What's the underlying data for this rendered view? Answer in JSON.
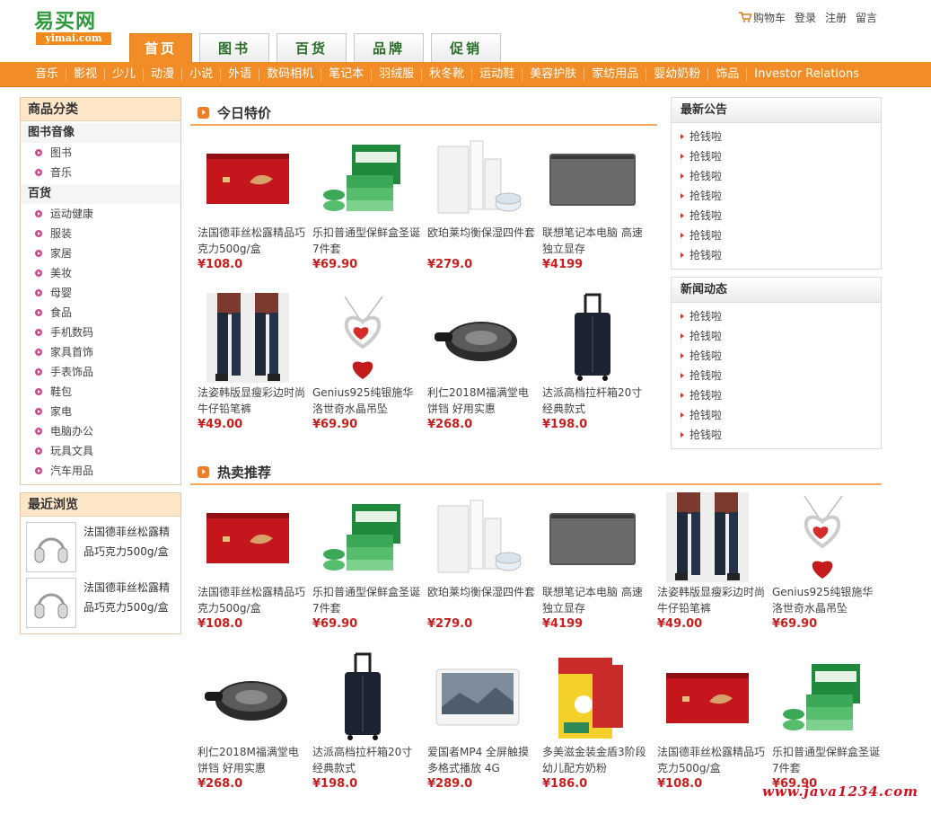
{
  "logo": {
    "cn": "易买网",
    "en": "yimai.com"
  },
  "top_links": {
    "cart": "购物车",
    "login": "登录",
    "register": "注册",
    "message": "留言"
  },
  "tabs": [
    {
      "label": "首页"
    },
    {
      "label": "图书"
    },
    {
      "label": "百货"
    },
    {
      "label": "品牌"
    },
    {
      "label": "促销"
    }
  ],
  "nav": [
    "音乐",
    "影视",
    "少儿",
    "动漫",
    "小说",
    "外语",
    "数码相机",
    "笔记本",
    "羽绒服",
    "秋冬靴",
    "运动鞋",
    "美容护肤",
    "家纺用品",
    "婴幼奶粉",
    "饰品",
    "Investor Relations"
  ],
  "categories": {
    "title": "商品分类",
    "groups": [
      {
        "name": "图书音像",
        "items": [
          "图书",
          "音乐"
        ]
      },
      {
        "name": "百货",
        "items": [
          "运动健康",
          "服装",
          "家居",
          "美妆",
          "母婴",
          "食品",
          "手机数码",
          "家具首饰",
          "手表饰品",
          "鞋包",
          "家电",
          "电脑办公",
          "玩具文具",
          "汽车用品"
        ]
      }
    ]
  },
  "recent": {
    "title": "最近浏览",
    "items": [
      {
        "name": "法国德菲丝松露精品巧克力500g/盒",
        "image": "headphone-icon"
      },
      {
        "name": "法国德菲丝松露精品巧克力500g/盒",
        "image": "headphone-icon"
      }
    ]
  },
  "specials": {
    "title": "今日特价",
    "products": [
      {
        "name": "法国德菲丝松露精品巧克力500g/盒",
        "price": "¥108.0",
        "image": "chocolate-box"
      },
      {
        "name": "乐扣普通型保鲜盒圣诞7件套",
        "price": "¥69.90",
        "image": "food-containers"
      },
      {
        "name": "欧珀莱均衡保湿四件套",
        "price": "¥279.0",
        "image": "skincare-set"
      },
      {
        "name": "联想笔记本电脑 高速独立显存",
        "price": "¥4199",
        "image": "laptop"
      },
      {
        "name": "法姿韩版显瘦彩边时尚牛仔铅笔裤",
        "price": "¥49.00",
        "image": "jeans"
      },
      {
        "name": "Genius925纯银施华洛世奇水晶吊坠",
        "price": "¥69.90",
        "image": "heart-pendant"
      },
      {
        "name": "利仁2018M福满堂电饼铛 好用实惠",
        "price": "¥268.0",
        "image": "electric-pan"
      },
      {
        "name": "达派高档拉杆箱20寸 经典款式",
        "price": "¥198.0",
        "image": "suitcase"
      }
    ]
  },
  "hot": {
    "title": "热卖推荐",
    "products": [
      {
        "name": "法国德菲丝松露精品巧克力500g/盒",
        "price": "¥108.0",
        "image": "chocolate-box"
      },
      {
        "name": "乐扣普通型保鲜盒圣诞7件套",
        "price": "¥69.90",
        "image": "food-containers"
      },
      {
        "name": "欧珀莱均衡保湿四件套",
        "price": "¥279.0",
        "image": "skincare-set"
      },
      {
        "name": "联想笔记本电脑 高速独立显存",
        "price": "¥4199",
        "image": "laptop"
      },
      {
        "name": "法姿韩版显瘦彩边时尚牛仔铅笔裤",
        "price": "¥49.00",
        "image": "jeans"
      },
      {
        "name": "Genius925纯银施华洛世奇水晶吊坠",
        "price": "¥69.90",
        "image": "heart-pendant"
      },
      {
        "name": "利仁2018M福满堂电饼铛 好用实惠",
        "price": "¥268.0",
        "image": "electric-pan"
      },
      {
        "name": "达派高档拉杆箱20寸 经典款式",
        "price": "¥198.0",
        "image": "suitcase"
      },
      {
        "name": "爱国者MP4 全屏触摸多格式播放 4G",
        "price": "¥289.0",
        "image": "mp4-player"
      },
      {
        "name": "多美滋金装金盾3阶段幼儿配方奶粉",
        "price": "¥186.0",
        "image": "milk-powder"
      },
      {
        "name": "法国德菲丝松露精品巧克力500g/盒",
        "price": "¥108.0",
        "image": "chocolate-box"
      },
      {
        "name": "乐扣普通型保鲜盒圣诞7件套",
        "price": "¥69.90",
        "image": "food-containers"
      }
    ]
  },
  "announcements": {
    "title": "最新公告",
    "items": [
      "抢钱啦",
      "抢钱啦",
      "抢钱啦",
      "抢钱啦",
      "抢钱啦",
      "抢钱啦",
      "抢钱啦"
    ]
  },
  "news": {
    "title": "新闻动态",
    "items": [
      "抢钱啦",
      "抢钱啦",
      "抢钱啦",
      "抢钱啦",
      "抢钱啦",
      "抢钱啦",
      "抢钱啦"
    ]
  },
  "watermark": "www.java1234.com",
  "colors": {
    "accent": "#f18c26",
    "price": "#c8201e",
    "logo_green": "#2e9a3a"
  }
}
